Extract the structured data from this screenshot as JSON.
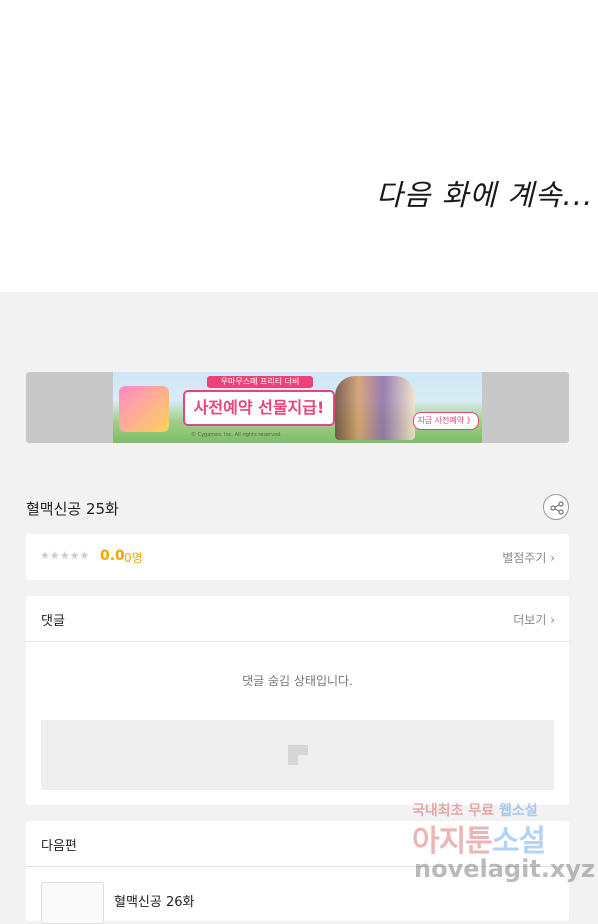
{
  "comic_panel": {
    "to_be_continued": "다음 화에 계속..."
  },
  "ad_banner": {
    "logo_text": "우마무스메",
    "sub_text": "우마무스메 프리티 더비",
    "headline": "사전예약 선물지급!",
    "cta": "지금 사전예약 》",
    "copyright": "© Cygames, Inc. All rights reserved.",
    "accent_color": "#e9437a"
  },
  "episode": {
    "title": "혈맥신공 25화",
    "share_icon": "share-icon"
  },
  "rating": {
    "stars": "★★★★★",
    "score": "0.0",
    "people": "0명",
    "rate_link": "별점주기 ›",
    "score_color": "#f5a300"
  },
  "comments": {
    "title": "댓글",
    "more_link": "더보기 ›",
    "hidden_message": "댓글 숨김 상태입니다.",
    "placeholder_icon": "comment-placeholder-icon"
  },
  "next_episode": {
    "heading": "다음편",
    "title": "혈맥신공 26화"
  },
  "watermark": {
    "line1_prefix": "국내최초 무료 ",
    "line1_highlight": "웹소설",
    "line2_prefix": "아지툰",
    "line2_highlight": "소설",
    "line3": "novelagit.xyz"
  }
}
